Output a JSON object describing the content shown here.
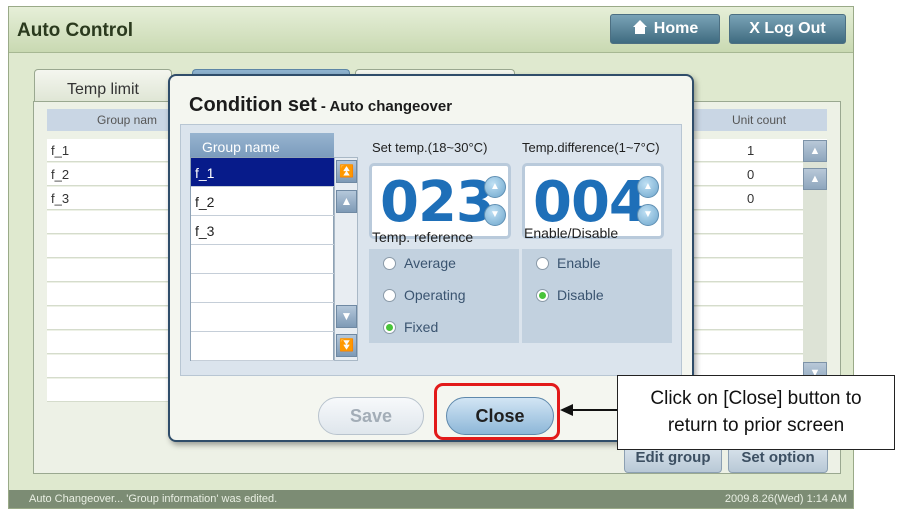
{
  "app": {
    "title": "Auto Control"
  },
  "header": {
    "home_label": "Home",
    "logout_label": "X Log Out"
  },
  "tabs": [
    {
      "label": "Temp limit"
    }
  ],
  "background_table": {
    "col_group": "Group nam",
    "col_unit_count": "Unit count",
    "rows": [
      {
        "name": "f_1",
        "count": "1"
      },
      {
        "name": "f_2",
        "count": "0"
      },
      {
        "name": "f_3",
        "count": "0"
      }
    ],
    "edit_group_label": "Edit group",
    "set_option_label": "Set option"
  },
  "dialog": {
    "title": "Condition set",
    "subtitle": " - Auto changeover",
    "group_list_header": "Group name",
    "groups": [
      "f_1",
      "f_2",
      "f_3"
    ],
    "set_temp_label": "Set temp.(18~30°C)",
    "set_temp_value": "023",
    "temp_diff_label": "Temp.difference(1~7°C)",
    "temp_diff_value": "004",
    "temp_reference_label": "Temp. reference",
    "temp_reference_options": [
      "Average",
      "Operating",
      "Fixed"
    ],
    "temp_reference_selected": "Fixed",
    "enable_disable_label": "Enable/Disable",
    "enable_options": [
      "Enable",
      "Disable"
    ],
    "enable_selected": "Disable",
    "save_label": "Save",
    "close_label": "Close"
  },
  "status": {
    "text": "Auto Changeover... 'Group information' was edited.",
    "time": "2009.8.26(Wed)  1:14 AM"
  },
  "annotation": {
    "line1": "Click on [Close] button to",
    "line2": "return to prior screen"
  },
  "icons": {
    "home": "home-icon",
    "arrow_up": "arrow-up-icon",
    "arrow_down": "arrow-down-icon"
  },
  "colors": {
    "accent": "#1e6fb8",
    "highlight": "#e21a1a",
    "selected_row": "#071b8a"
  }
}
